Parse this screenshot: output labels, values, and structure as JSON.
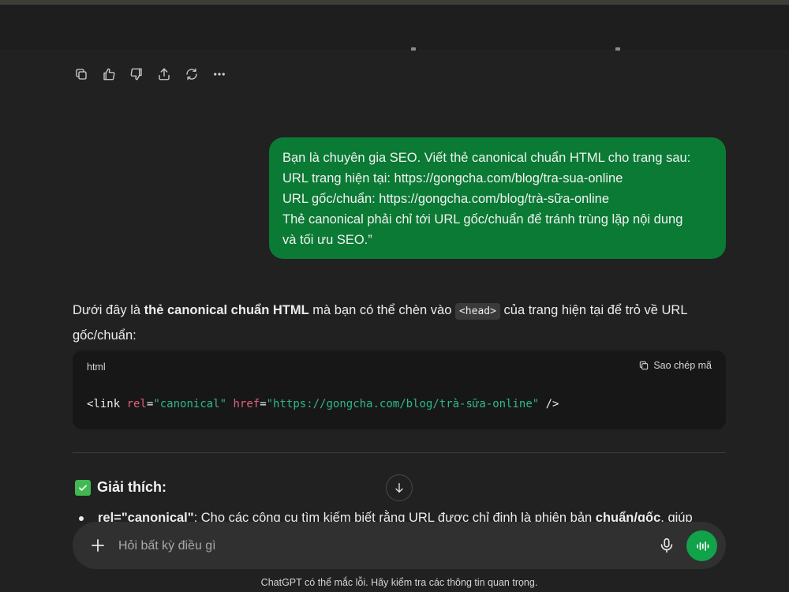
{
  "message_actions": {
    "icons": [
      "copy-icon",
      "thumbs-up-icon",
      "thumbs-down-icon",
      "share-icon",
      "regenerate-icon",
      "more-icon"
    ]
  },
  "user_message": {
    "lines": [
      "Bạn là chuyên gia SEO. Viết thẻ canonical chuẩn HTML cho trang sau:",
      "URL trang hiện tại: https://gongcha.com/blog/tra-sua-online",
      "URL gốc/chuẩn: https://gongcha.com/blog/trà-sữa-online",
      "Thẻ canonical phải chỉ tới URL gốc/chuẩn để tránh trùng lặp nội dung",
      "và tối ưu SEO.”"
    ]
  },
  "answer": {
    "intro_before": "Dưới đây là ",
    "intro_bold": "thẻ canonical chuẩn HTML",
    "intro_middle": " mà bạn có thể chèn vào ",
    "intro_code": "<head>",
    "intro_after": " của trang hiện tại để trỏ về URL gốc/chuẩn:",
    "code_block": {
      "language": "html",
      "copy_label": "Sao chép mã",
      "tag_open": "<link ",
      "attr1_name": "rel",
      "eq1": "=",
      "attr1_value": "\"canonical\"",
      "space": " ",
      "attr2_name": "href",
      "eq2": "=",
      "attr2_value": "\"https://gongcha.com/blog/trà-sữa-online\"",
      "tag_close": " />"
    },
    "section_heading": "Giải thích:",
    "bullet_bold": "rel=\"canonical\"",
    "bullet_text": ": Cho các công cụ tìm kiếm biết rằng URL được chỉ định là phiên bản ",
    "bullet_bold2": "chuẩn/gốc",
    "bullet_tail": ", giúp"
  },
  "composer": {
    "placeholder": "Hỏi bất kỳ điều gì"
  },
  "footer": {
    "disclaimer": "ChatGPT có thể mắc lỗi. Hãy kiểm tra các thông tin quan trọng."
  },
  "colors": {
    "background": "#212121",
    "user_bubble": "#0a7a34",
    "code_background": "#171717",
    "composer": "#303030",
    "voice_button": "#11a24a",
    "code_attr": "#e0607e",
    "code_string": "#2fb889"
  }
}
